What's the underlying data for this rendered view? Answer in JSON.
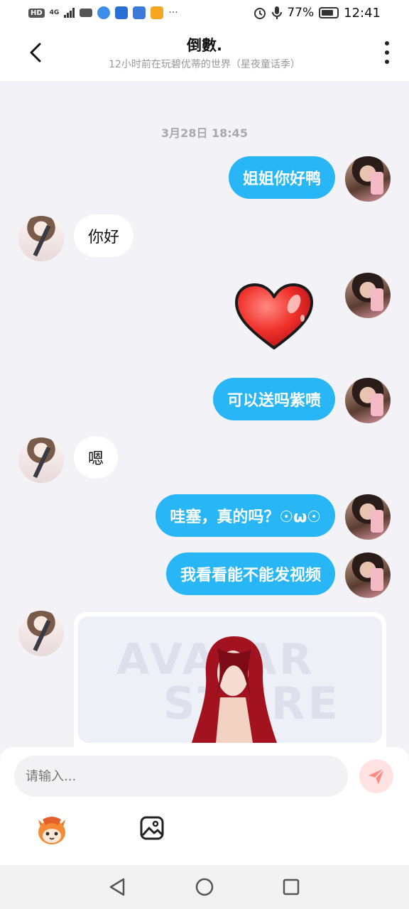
{
  "status_bar": {
    "hd_badge": "HD",
    "network": "4G",
    "more": "···",
    "battery": "77%",
    "time": "12:41"
  },
  "header": {
    "title": "倒數.",
    "subtitle": "12小时前在玩碧优蒂的世界（星夜童话季）",
    "back_icon": "chevron-left-icon",
    "more_icon": "more-vertical-icon"
  },
  "chat": {
    "timestamp": "3月28日 18:45",
    "messages": [
      {
        "from": "me",
        "type": "text",
        "text": "姐姐你好鸭"
      },
      {
        "from": "other",
        "type": "text",
        "text": "你好"
      },
      {
        "from": "me",
        "type": "sticker",
        "sticker": "red-heart"
      },
      {
        "from": "me",
        "type": "text",
        "text": "可以送吗紫啧"
      },
      {
        "from": "other",
        "type": "text",
        "text": "嗯"
      },
      {
        "from": "me",
        "type": "text",
        "text": "哇塞，真的吗？☉ω☉"
      },
      {
        "from": "me",
        "type": "text",
        "text": "我看看能不能发视频"
      },
      {
        "from": "other",
        "type": "video",
        "watermark_1": "AVATAR",
        "watermark_2": "STORE"
      }
    ]
  },
  "input": {
    "placeholder": "请输入..."
  },
  "colors": {
    "my_bubble": "#29b6f6",
    "send_button_bg": "#ffe3e2",
    "send_icon": "#ff8a80"
  }
}
